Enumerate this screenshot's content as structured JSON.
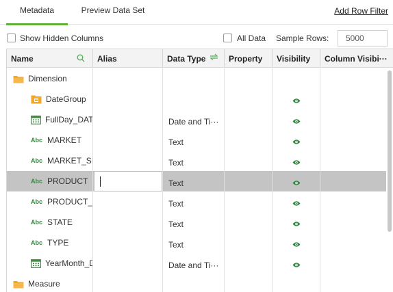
{
  "tabs": [
    {
      "label": "Metadata",
      "active": true
    },
    {
      "label": "Preview Data Set",
      "active": false
    }
  ],
  "add_row_filter": "Add Row Filter",
  "options": {
    "show_hidden_columns": "Show Hidden Columns",
    "all_data": "All Data",
    "sample_rows_label": "Sample Rows:",
    "sample_rows_value": "5000"
  },
  "columns": [
    "Name",
    "Alias",
    "Data Type",
    "Property",
    "Visibility",
    "Column Visibi···"
  ],
  "rows": [
    {
      "name": "Dimension",
      "icon": "folder-icon",
      "type": "",
      "visible": false
    },
    {
      "name": "DateGroup",
      "icon": "date-group-icon",
      "type": "",
      "visible": true
    },
    {
      "name": "FullDay_DAT",
      "icon": "calendar-icon",
      "type": "Date and Ti···",
      "visible": true
    },
    {
      "name": "MARKET",
      "icon": "text-field-icon",
      "type": "Text",
      "visible": true
    },
    {
      "name": "MARKET_SI",
      "icon": "text-field-icon",
      "type": "Text",
      "visible": true
    },
    {
      "name": "PRODUCT",
      "icon": "text-field-icon",
      "type": "Text",
      "visible": true,
      "selected": true
    },
    {
      "name": "PRODUCT_T",
      "icon": "text-field-icon",
      "type": "Text",
      "visible": true
    },
    {
      "name": "STATE",
      "icon": "text-field-icon",
      "type": "Text",
      "visible": true
    },
    {
      "name": "TYPE",
      "icon": "text-field-icon",
      "type": "Text",
      "visible": true
    },
    {
      "name": "YearMonth_D",
      "icon": "calendar-icon",
      "type": "Date and Ti···",
      "visible": true
    },
    {
      "name": "Measure",
      "icon": "folder-icon",
      "type": "",
      "visible": false
    }
  ],
  "icon_text": {
    "abc": "Abc"
  },
  "colors": {
    "accent": "#5fb233",
    "eye": "#2e8b3e",
    "folder": "#f5a623",
    "selected_row": "#c4c4c4"
  }
}
